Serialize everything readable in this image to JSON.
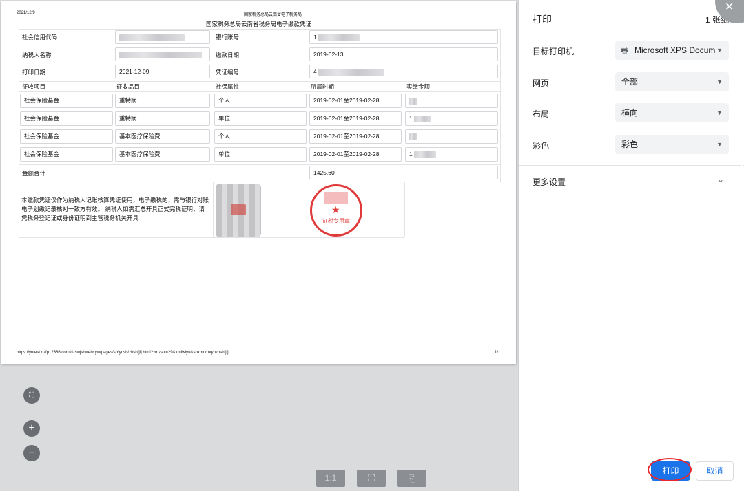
{
  "document": {
    "date": "2021/12/9",
    "site_title": "国家税务总局云南省电子税务局",
    "title": "国家税务总局云南省税务局电子缴款凭证",
    "footer_url": "https://yntest.dzfp12366.com/dzswjsbwebxyw/pages/sb/ynsb/zhsbfjfj.html?xmzslx=29&xmfwly=&sbxmdm=ynzhsbfjfj",
    "page_number": "1/1",
    "fields": {
      "credit_code_label": "社会信用代码",
      "bank_account_label": "银行账号",
      "bank_account_value": "1",
      "taxpayer_label": "纳税人名称",
      "payment_date_label": "缴款日期",
      "payment_date_value": "2019-02-13",
      "print_date_label": "打印日期",
      "print_date_value": "2021-12-09",
      "voucher_no_label": "凭证编号",
      "voucher_no_value": "4"
    },
    "table_headers": [
      "征收项目",
      "征收品目",
      "社保属性",
      "所属时期",
      "实缴金额"
    ],
    "rows": [
      {
        "item": "社会保险基金",
        "category": "重特病",
        "attr": "个人",
        "period": "2019-02-01至2019-02-28",
        "amount": ""
      },
      {
        "item": "社会保险基金",
        "category": "重特病",
        "attr": "单位",
        "period": "2019-02-01至2019-02-28",
        "amount": "1"
      },
      {
        "item": "社会保险基金",
        "category": "基本医疗保险费",
        "attr": "个人",
        "period": "2019-02-01至2019-02-28",
        "amount": ""
      },
      {
        "item": "社会保险基金",
        "category": "基本医疗保险费",
        "attr": "单位",
        "period": "2019-02-01至2019-02-28",
        "amount": "1"
      }
    ],
    "total_label": "金额合计",
    "total_value": "1425.60",
    "note": "本缴款凭证仅作为纳税人记账核算凭证使用，电子缴税的，需与银行对账电子划缴记录核对一致方有效。 纳税人如需汇总开具正式完税证明，请凭税务登记证或身份证明到主管税务机关开具",
    "stamp_text": "征税专用章"
  },
  "settings": {
    "title": "打印",
    "sheet_count": "1 张纸",
    "destination_label": "目标打印机",
    "destination_value": "Microsoft XPS Docum",
    "pages_label": "网页",
    "pages_value": "全部",
    "layout_label": "布局",
    "layout_value": "横向",
    "color_label": "彩色",
    "color_value": "彩色",
    "more_settings": "更多设置",
    "print_button": "打印",
    "cancel_button": "取消"
  },
  "preview_controls": {
    "zoom_in": "+",
    "zoom_out": "−",
    "actual_size": "1:1"
  },
  "colors": {
    "accent": "#1a73e8",
    "highlight": "#e8262b"
  }
}
